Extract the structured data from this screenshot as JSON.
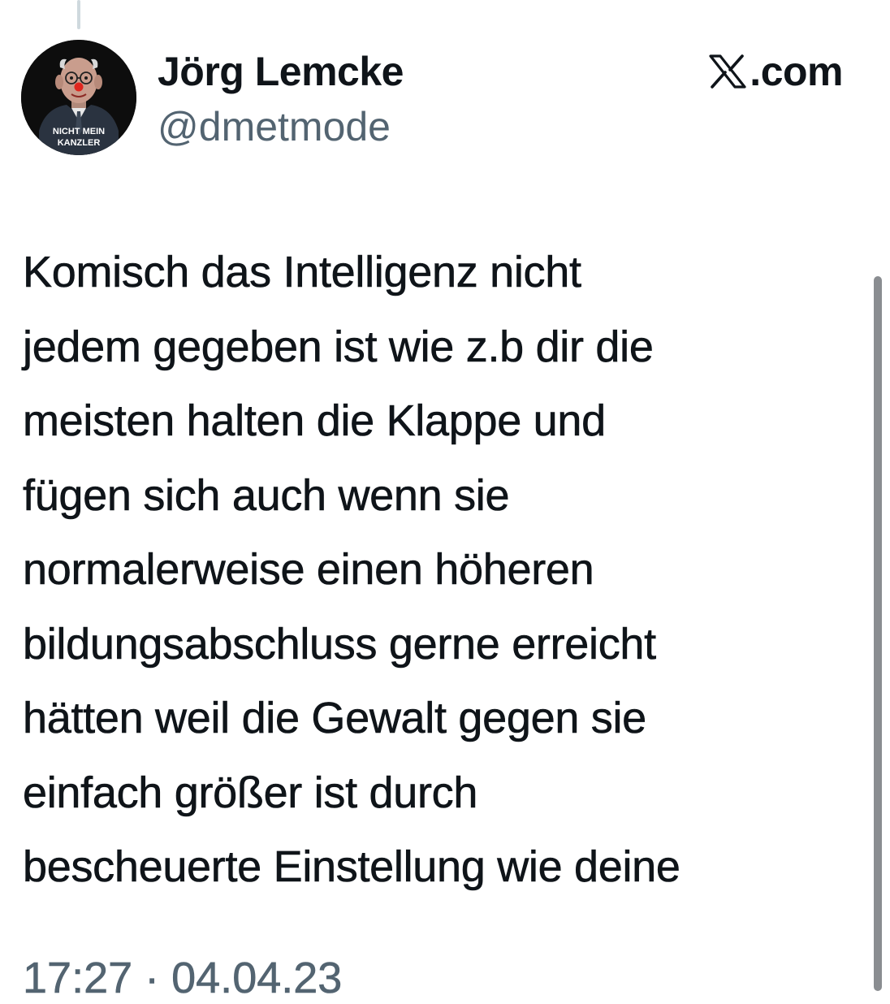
{
  "author": {
    "display_name": "Jörg Lemcke",
    "handle": "@dmetmode",
    "avatar_caption": [
      "NICHT MEIN",
      "KANZLER"
    ]
  },
  "brand": {
    "icon": "x-logo-icon",
    "label": ".com"
  },
  "tweet": {
    "lines": [
      "Komisch das Intelligenz nicht",
      "jedem gegeben ist wie z.b dir die",
      "meisten halten die Klappe und",
      "fügen sich auch wenn sie",
      "normalerweise einen höheren",
      "bildungsabschluss gerne erreicht",
      "hätten weil die Gewalt gegen sie",
      "einfach größer ist durch",
      "bescheuerte Einstellung wie deine"
    ],
    "timestamp": "17:27 · 04.04.23"
  },
  "colors": {
    "text": "#0f1419",
    "secondary": "#536471",
    "thread_line": "#cfd9de",
    "scrollbar": "#8a8d91"
  }
}
